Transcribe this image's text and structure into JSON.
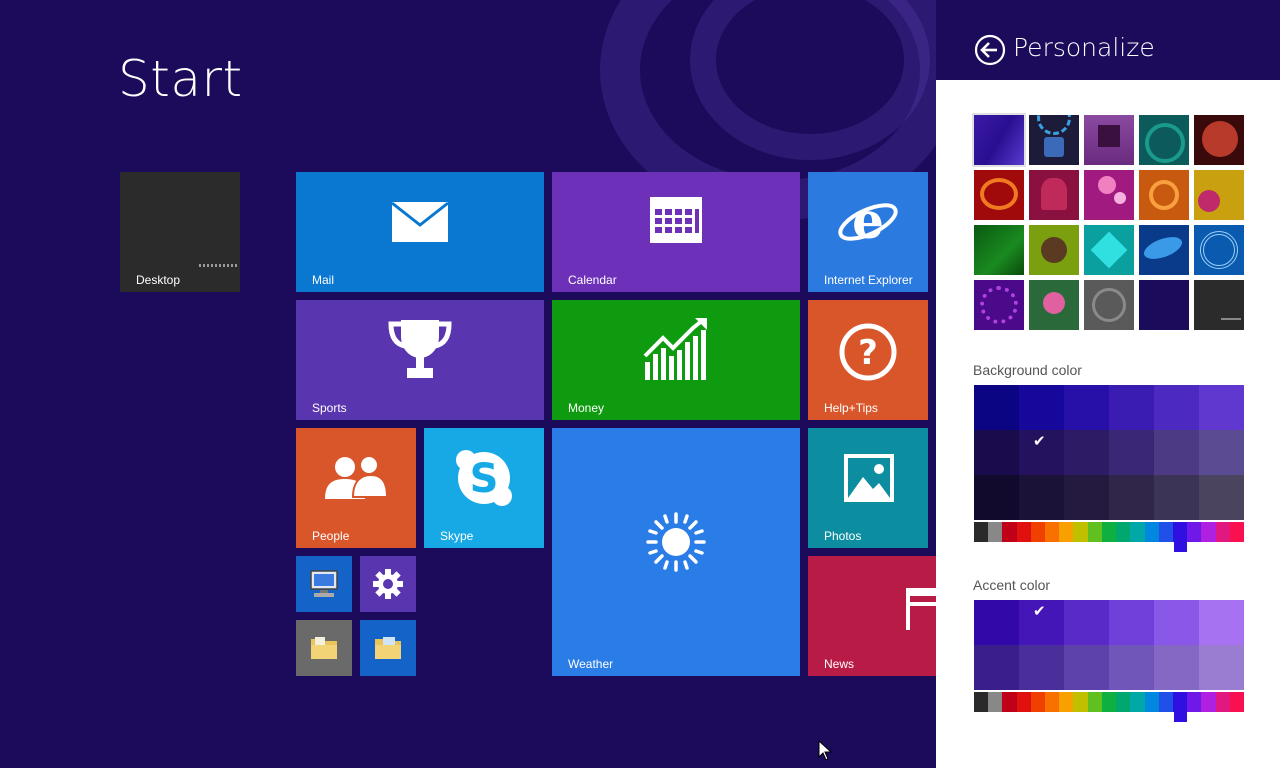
{
  "start": {
    "title": "Start",
    "tiles": [
      {
        "id": "desktop",
        "label": "Desktop",
        "color": "#2b2b2b"
      },
      {
        "id": "mail",
        "label": "Mail",
        "color": "#0a78d0"
      },
      {
        "id": "calendar",
        "label": "Calendar",
        "color": "#6c31b8"
      },
      {
        "id": "ie",
        "label": "Internet Explorer",
        "color": "#2a7ae0"
      },
      {
        "id": "sports",
        "label": "Sports",
        "color": "#5a35b0"
      },
      {
        "id": "money",
        "label": "Money",
        "color": "#0f9b0f"
      },
      {
        "id": "help",
        "label": "Help+Tips",
        "color": "#d8562a"
      },
      {
        "id": "people",
        "label": "People",
        "color": "#d8562a"
      },
      {
        "id": "skype",
        "label": "Skype",
        "color": "#16a9e6"
      },
      {
        "id": "weather",
        "label": "Weather",
        "color": "#2a7de6"
      },
      {
        "id": "photos",
        "label": "Photos",
        "color": "#0d8da0"
      },
      {
        "id": "news",
        "label": "News",
        "color": "#b81c46"
      }
    ]
  },
  "personalize": {
    "title": "Personalize",
    "background_label": "Background color",
    "accent_label": "Accent color",
    "background_colors": [
      "#0b0583",
      "#17089c",
      "#2610a8",
      "#3a1cb3",
      "#4c2ac2",
      "#6038d0",
      "#1a0b4d",
      "#24125e",
      "#2e1b66",
      "#3a2775",
      "#4c3b84",
      "#5b4b92",
      "#120a2c",
      "#1b1238",
      "#241a40",
      "#2f2649",
      "#3c3456",
      "#4b445f"
    ],
    "accent_colors": [
      "#3208a8",
      "#4416b8",
      "#5a2ac8",
      "#7140da",
      "#8a58e8",
      "#a672f2",
      "#3a1e8a",
      "#4a2f9a",
      "#5c42aa",
      "#6f56b8",
      "#8468c4",
      "#9a7cd0"
    ],
    "hue_colors": [
      "#2a2a2a",
      "#888888",
      "#c00018",
      "#e01010",
      "#f04000",
      "#f87000",
      "#f8a000",
      "#c0c000",
      "#60c020",
      "#10b040",
      "#00a870",
      "#00a8a8",
      "#0088e0",
      "#2050e8",
      "#3010e0",
      "#7018e8",
      "#b020e0",
      "#e01880",
      "#f81050"
    ],
    "selection": {
      "background": "2 of 6, row 2",
      "accent": "2 of 6, row 1"
    },
    "check_mark": "✔"
  }
}
